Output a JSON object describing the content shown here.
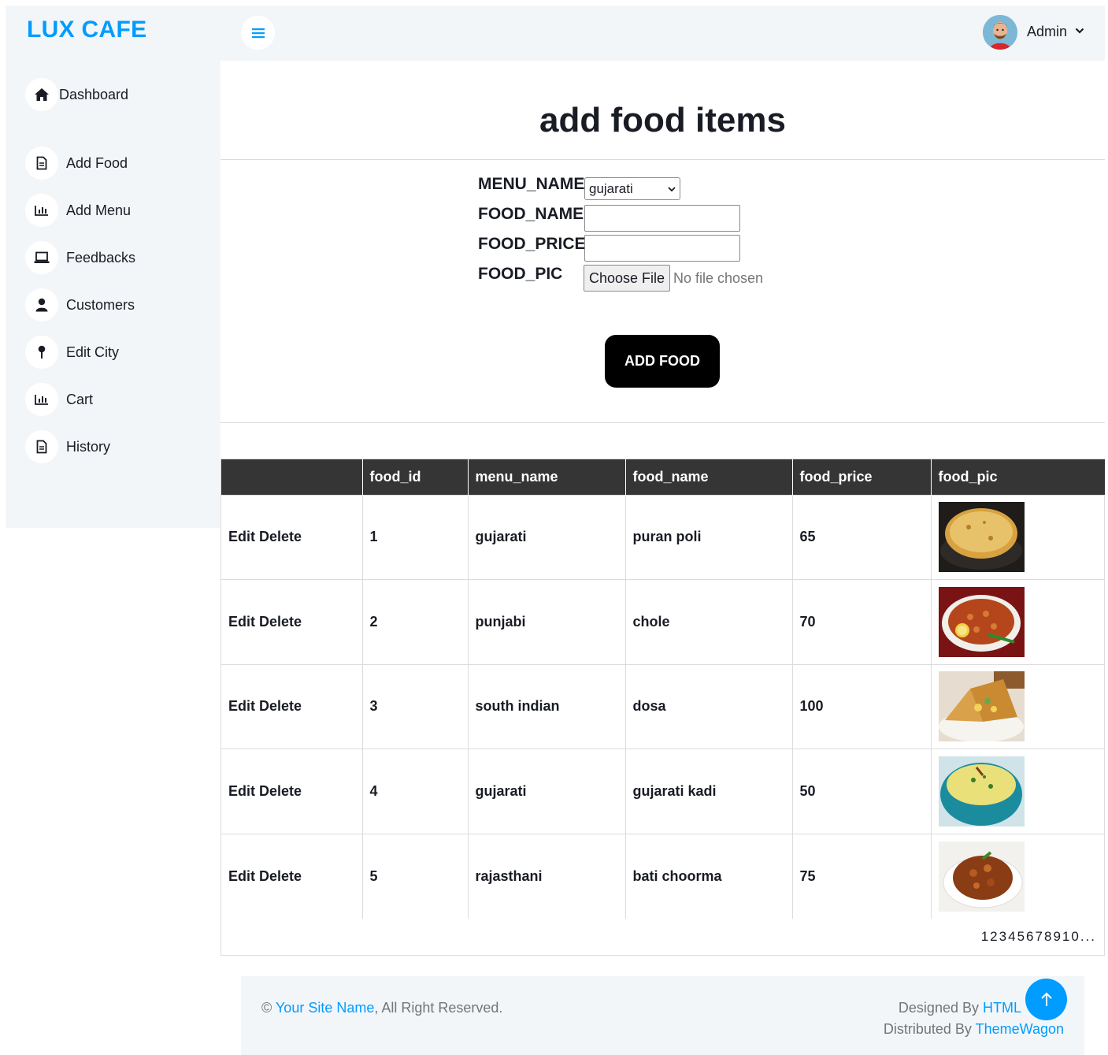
{
  "brand": "LUX CAFE",
  "topbar": {
    "user_name": "Admin"
  },
  "sidebar": {
    "items": [
      {
        "label": "Dashboard",
        "icon": "home-icon"
      },
      {
        "label": "Add Food",
        "icon": "file-icon"
      },
      {
        "label": "Add Menu",
        "icon": "bar-chart-icon"
      },
      {
        "label": "Feedbacks",
        "icon": "laptop-icon"
      },
      {
        "label": "Customers",
        "icon": "user-icon"
      },
      {
        "label": "Edit City",
        "icon": "pin-icon"
      },
      {
        "label": "Cart",
        "icon": "bar-chart-icon"
      },
      {
        "label": "History",
        "icon": "file-icon"
      }
    ]
  },
  "main": {
    "title": "add food items",
    "form": {
      "menu_label": "MENU_NAME",
      "menu_value": "gujarati",
      "name_label": "FOOD_NAME",
      "name_value": "",
      "price_label": "FOOD_PRICE",
      "price_value": "",
      "pic_label": "FOOD_PIC",
      "file_button": "Choose File",
      "file_status": "No file chosen",
      "submit": "ADD FOOD"
    },
    "table": {
      "headers": [
        "",
        "food_id",
        "menu_name",
        "food_name",
        "food_price",
        "food_pic"
      ],
      "edit_label": "Edit",
      "delete_label": "Delete",
      "rows": [
        {
          "id": "1",
          "menu": "gujarati",
          "name": "puran poli",
          "price": "65"
        },
        {
          "id": "2",
          "menu": "punjabi",
          "name": "chole",
          "price": "70"
        },
        {
          "id": "3",
          "menu": "south indian",
          "name": "dosa",
          "price": "100"
        },
        {
          "id": "4",
          "menu": "gujarati",
          "name": "gujarati kadi",
          "price": "50"
        },
        {
          "id": "5",
          "menu": "rajasthani",
          "name": "bati choorma",
          "price": "75"
        }
      ],
      "pages": [
        "1",
        "2",
        "3",
        "4",
        "5",
        "6",
        "7",
        "8",
        "9",
        "10",
        "..."
      ]
    }
  },
  "footer": {
    "copyright": "©",
    "site_name": "Your Site Name",
    "rights": ", All Right Reserved.",
    "designed_by": "Designed By",
    "designer": "HTML",
    "distributed_by": "Distributed By",
    "distributor": "ThemeWagon"
  },
  "colors": {
    "accent": "#009cff",
    "sidebar_bg": "#f3f6f9",
    "table_header": "#353535",
    "button": "#000000"
  }
}
